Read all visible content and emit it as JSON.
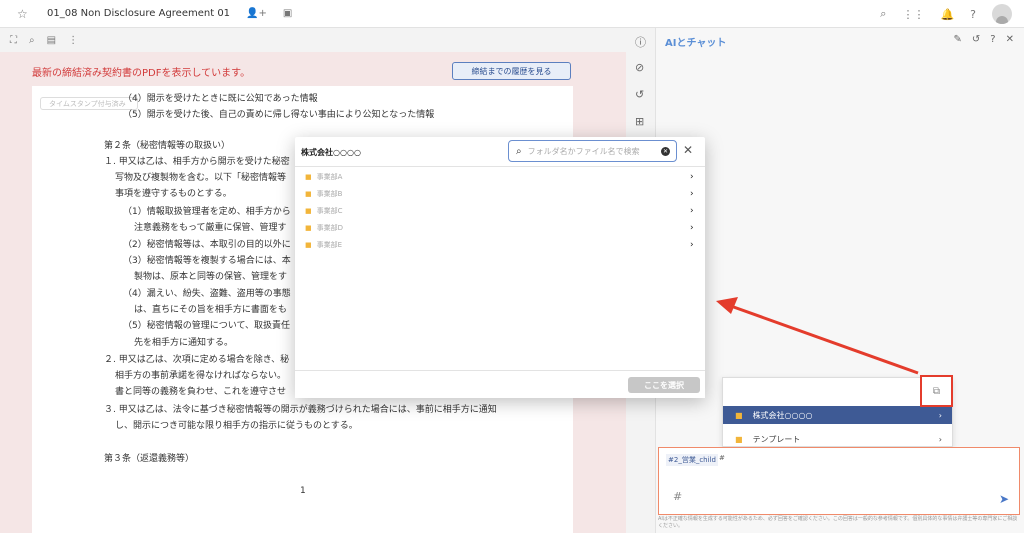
{
  "topbar": {
    "title": "01_08 Non Disclosure Agreement 01"
  },
  "notice": {
    "pdf_text": "最新の締結済み契約書のPDFを表示しています。",
    "history_button": "締結までの履歴を見る",
    "timestamp_badge": "タイムスタンプ付与済み"
  },
  "document": {
    "lines": [
      "（4）開示を受けたときに既に公知であった情報",
      "（5）開示を受けた後、自己の責めに帰し得ない事由により公知となった情報",
      "第２条（秘密情報等の取扱い）",
      "１. 甲又は乙は、相手方から開示を受けた秘密",
      "写物及び複製物を含む。以下「秘密情報等",
      "事項を遵守するものとする。",
      "（1）情報取扱管理者を定め、相手方から",
      "注意義務をもって厳重に保管、管理す",
      "（2）秘密情報等は、本取引の目的以外に",
      "（3）秘密情報等を複製する場合には、本",
      "製物は、原本と同等の保管、管理をす",
      "（4）漏えい、紛失、盗難、盗用等の事態",
      "は、直ちにその旨を相手方に書面をも",
      "（5）秘密情報の管理について、取扱責任",
      "先を相手方に通知する。",
      "２. 甲又は乙は、次項に定める場合を除き、秘",
      "相手方の事前承諾を得なければならない。",
      "書と同等の義務を負わせ、これを遵守させ",
      "３. 甲又は乙は、法令に基づき秘密情報等の開示が義務づけられた場合には、事前に相手方に通知",
      "し、開示につき可能な限り相手方の指示に従うものとする。",
      "第３条（返還義務等）"
    ],
    "page_number": "1"
  },
  "ai_panel": {
    "title": "AIとチャット",
    "menu": {
      "items": [
        {
          "label": "株式会社○○○○"
        },
        {
          "label": "テンプレート"
        }
      ]
    },
    "chat": {
      "mention": "#2_営業_child",
      "mention_suffix": "#",
      "input_hash": "#"
    },
    "disclaimer": "AIは不正確な情報を生成する可能性があるため、必ず回答をご確認ください。この回答は一般的な参考情報です。個別具体的な事情は弁護士等の専門家にご相談ください。"
  },
  "modal": {
    "title": "株式会社○○○○",
    "search_placeholder": "フォルダ名かファイル名で検索",
    "rows": [
      {
        "label": "事業部A"
      },
      {
        "label": "事業部B"
      },
      {
        "label": "事業部C"
      },
      {
        "label": "事業部D"
      },
      {
        "label": "事業部E"
      }
    ],
    "select_button": "ここを選択"
  },
  "colors": {
    "accent": "#3e5a95",
    "highlight_red": "#e43c2c",
    "folder": "#f2b53a"
  }
}
